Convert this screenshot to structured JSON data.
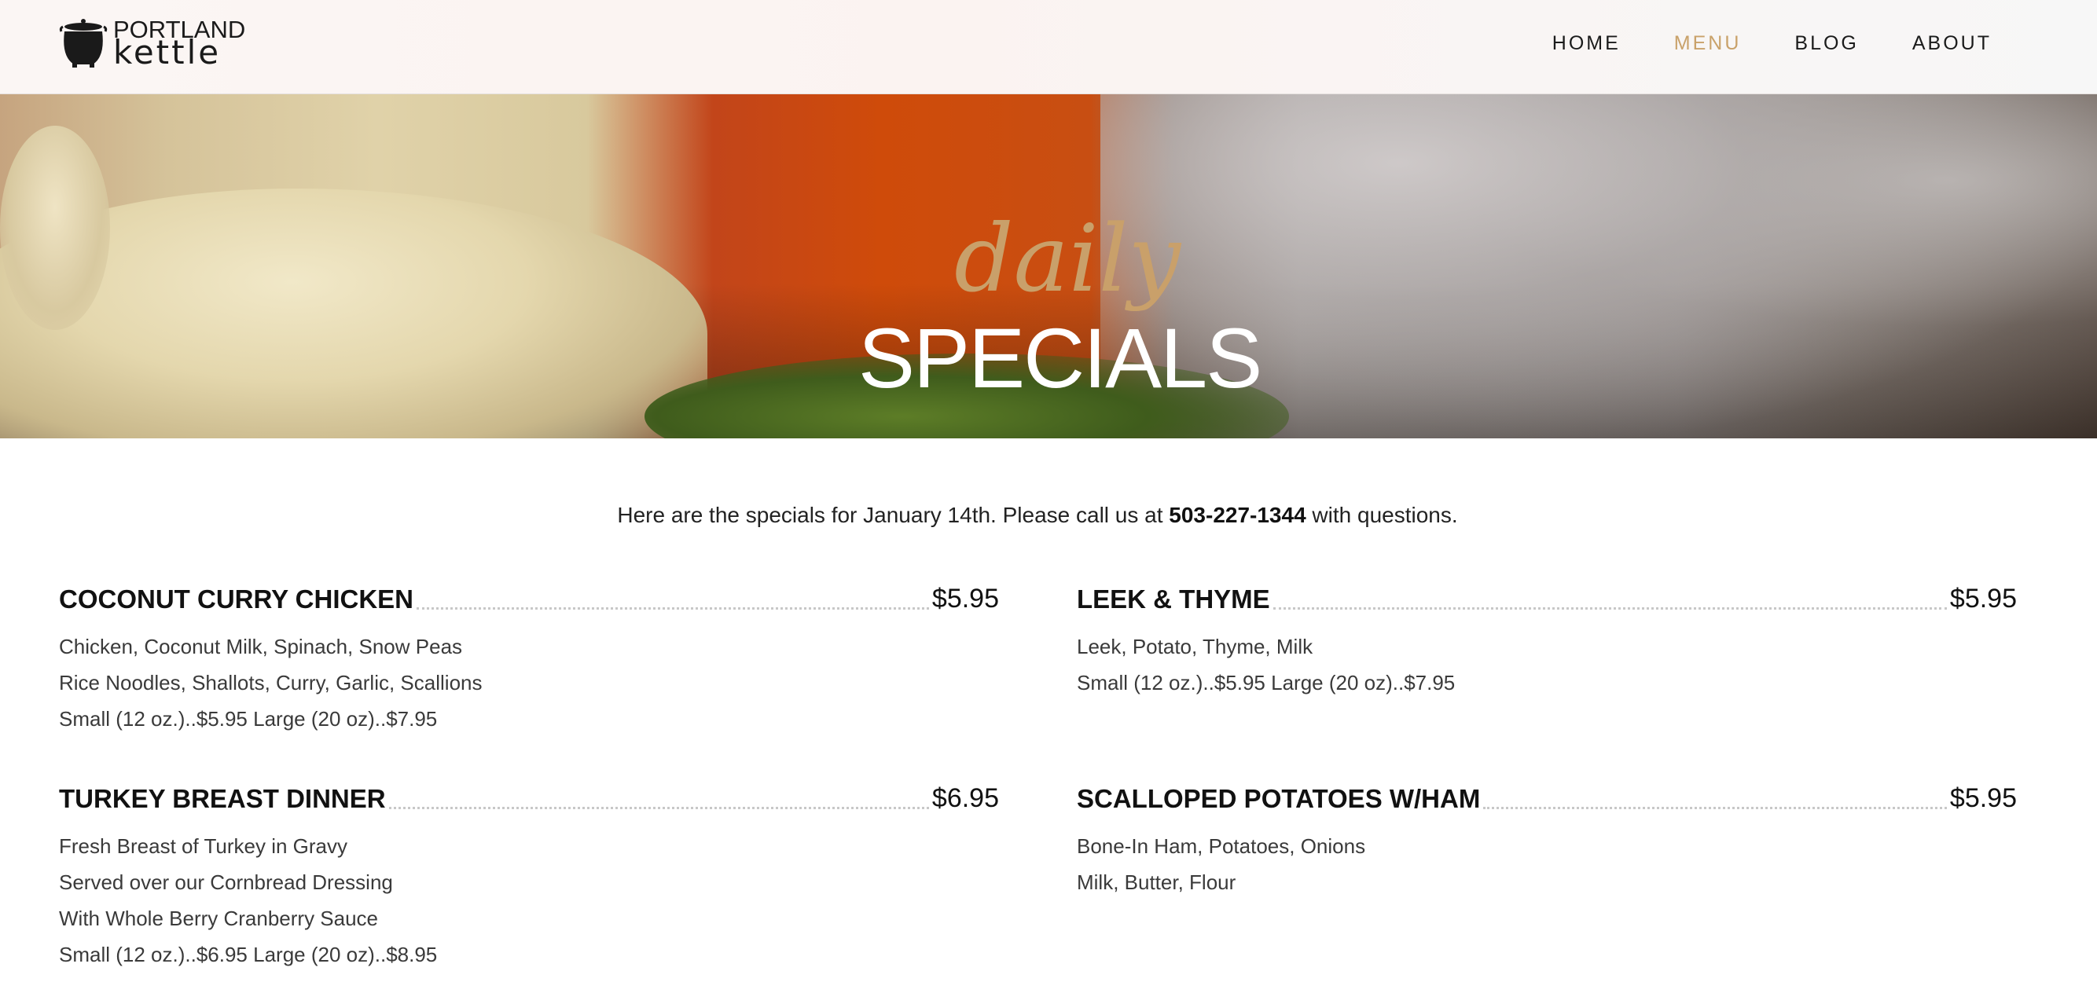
{
  "brand": {
    "top": "PORTLAND",
    "bottom": "kettle",
    "icon": "kettle-pot-icon"
  },
  "nav": [
    {
      "label": "HOME",
      "active": false
    },
    {
      "label": "MENU",
      "active": true
    },
    {
      "label": "BLOG",
      "active": false
    },
    {
      "label": "ABOUT",
      "active": false
    }
  ],
  "hero": {
    "script_title": "daily",
    "main_title": "SPECIALS"
  },
  "intro": {
    "before": "Here are the specials for January 14th. Please call us at ",
    "phone": "503-227-1344",
    "after": " with questions."
  },
  "items": [
    {
      "name": "COCONUT CURRY CHICKEN",
      "price": "$5.95",
      "lines": [
        "Chicken, Coconut Milk, Spinach, Snow Peas",
        "Rice Noodles, Shallots, Curry, Garlic, Scallions",
        "Small (12 oz.)..$5.95 Large (20 oz)..$7.95"
      ]
    },
    {
      "name": "LEEK & THYME",
      "price": "$5.95",
      "lines": [
        "Leek, Potato, Thyme, Milk",
        "Small (12 oz.)..$5.95 Large (20 oz)..$7.95"
      ]
    },
    {
      "name": "TURKEY BREAST DINNER",
      "price": "$6.95",
      "lines": [
        "Fresh Breast of Turkey in Gravy",
        "Served over our Cornbread Dressing",
        "With Whole Berry Cranberry Sauce",
        "Small (12 oz.)..$6.95 Large (20 oz)..$8.95"
      ]
    },
    {
      "name": "SCALLOPED POTATOES W/HAM",
      "price": "$5.95",
      "lines": [
        "Bone-In Ham, Potatoes, Onions",
        "Milk, Butter, Flour"
      ]
    }
  ],
  "colors": {
    "accent": "#c9a26a",
    "text": "#222222"
  }
}
